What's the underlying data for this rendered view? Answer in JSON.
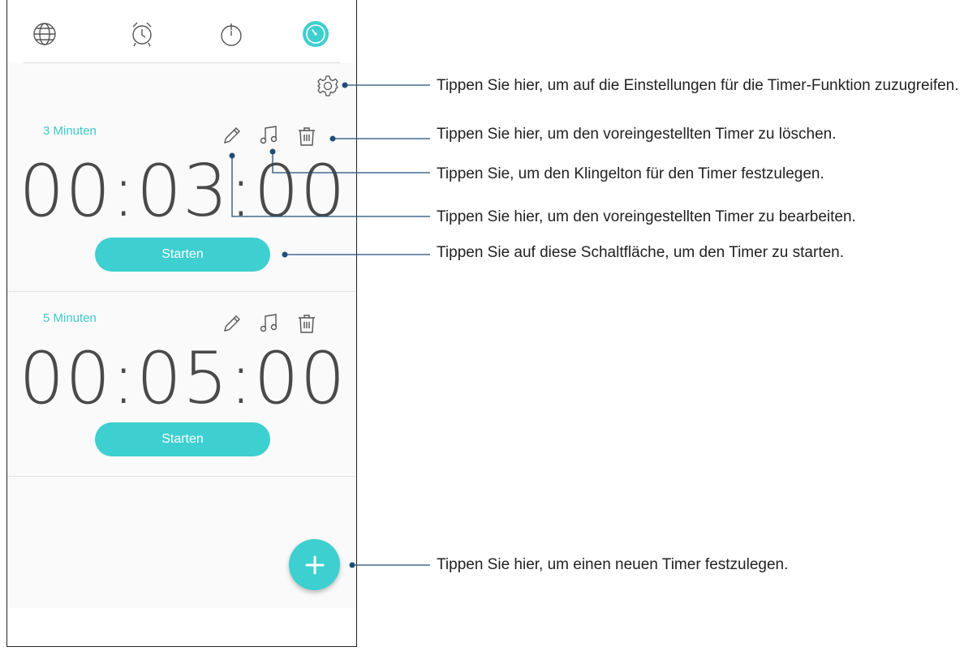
{
  "tabs": [
    {
      "icon": "globe-icon",
      "label": "World clock"
    },
    {
      "icon": "alarm-clock-icon",
      "label": "Alarm"
    },
    {
      "icon": "stopwatch-icon",
      "label": "Stopwatch"
    },
    {
      "icon": "timer-icon",
      "label": "Timer",
      "active": true
    }
  ],
  "accent_color": "#3ecfd0",
  "timers": [
    {
      "label": "3 Minuten",
      "time": "00:03:00",
      "start_label": "Starten"
    },
    {
      "label": "5 Minuten",
      "time": "00:05:00",
      "start_label": "Starten"
    }
  ],
  "callouts": {
    "settings": "Tippen Sie hier, um auf die Einstellungen für die Timer-Funktion zuzugreifen.",
    "delete": "Tippen Sie hier, um den voreingestellten Timer zu löschen.",
    "ringtone": "Tippen Sie, um den Klingelton für den Timer festzulegen.",
    "edit": "Tippen Sie hier, um den voreingestellten Timer zu bearbeiten.",
    "start": "Tippen Sie auf diese Schaltfläche, um den Timer zu starten.",
    "add": "Tippen Sie hier, um einen neuen Timer festzulegen."
  }
}
